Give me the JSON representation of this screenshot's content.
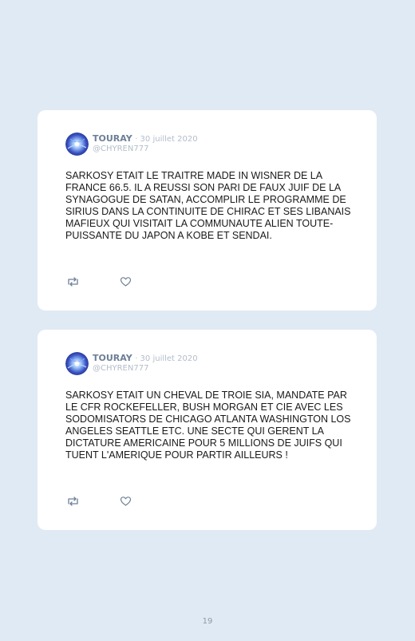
{
  "colors": {
    "background": "#dfeaf4",
    "card": "#ffffff",
    "author": "#6d7f97",
    "muted": "#b3bdca",
    "icon": "#6d7f97"
  },
  "tweets": [
    {
      "author": "TOURAY",
      "date": "· 30 juillet 2020",
      "handle": "@CHYREN777",
      "text": "SARKOSY ETAIT LE TRAITRE MADE IN WISNER DE LA FRANCE 66.5. IL A REUSSI SON PARI DE FAUX JUIF DE LA SYNAGOGUE DE SATAN, ACCOMPLIR LE PROGRAMME DE SIRIUS DANS LA CONTINUITE DE CHIRAC ET SES LIBANAIS MAFIEUX QUI VISITAIT LA COMMUNAUTE ALIEN TOUTE-PUISSANTE DU JAPON A KOBE ET SENDAI.",
      "icons": [
        "retweet-icon",
        "heart-icon"
      ]
    },
    {
      "author": "TOURAY",
      "date": "· 30 juillet 2020",
      "handle": "@CHYREN777",
      "text": "SARKOSY ETAIT UN CHEVAL DE TROIE SIA, MANDATE PAR LE CFR ROCKEFELLER, BUSH MORGAN ET CIE AVEC LES SODOMISATORS DE CHICAGO ATLANTA WASHINGTON LOS ANGELES SEATTLE ETC. UNE SECTE QUI GERENT LA DICTATURE AMERICAINE POUR 5 MILLIONS DE JUIFS QUI TUENT L'AMERIQUE POUR PARTIR AILLEURS !",
      "icons": [
        "retweet-icon",
        "heart-icon"
      ]
    }
  ],
  "page_number": "19"
}
